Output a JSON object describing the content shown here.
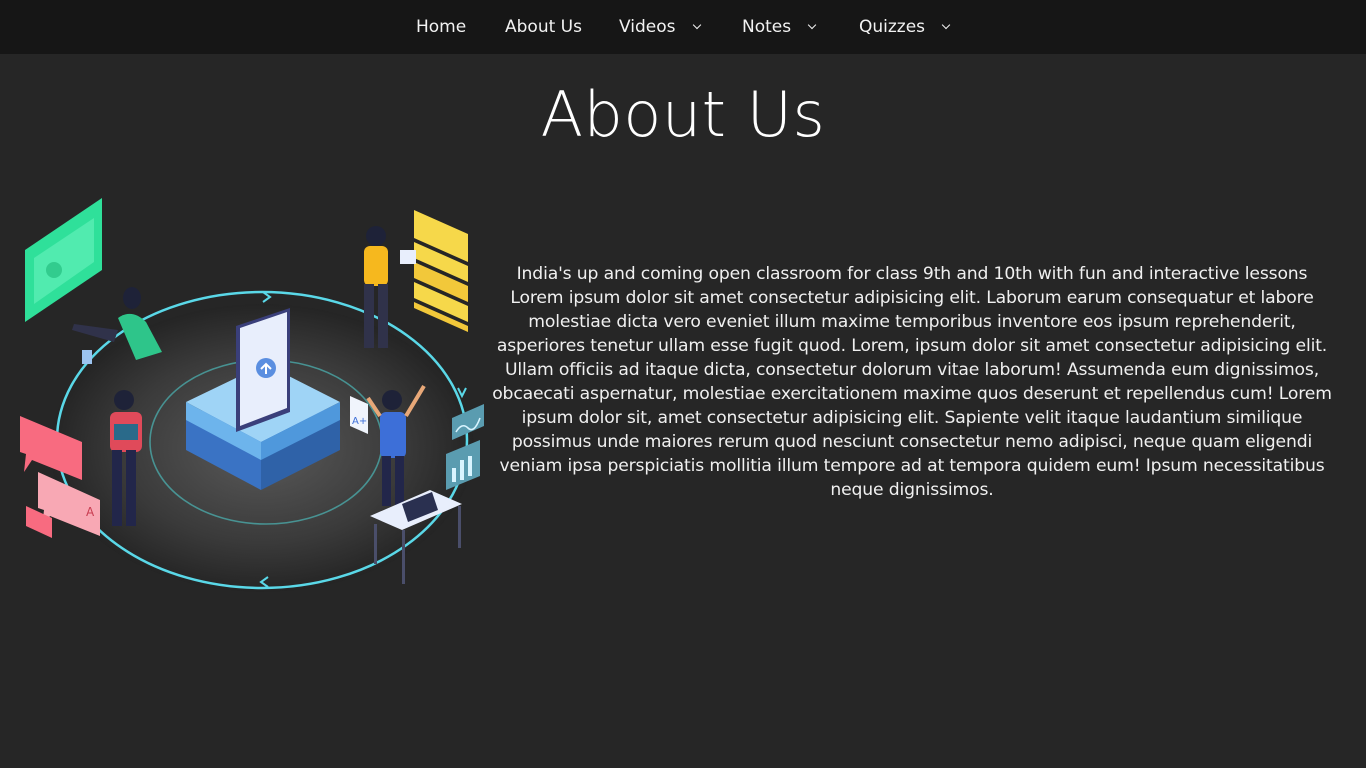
{
  "nav": {
    "items": [
      {
        "label": "Home",
        "dropdown": false
      },
      {
        "label": "About Us",
        "dropdown": false
      },
      {
        "label": "Videos",
        "dropdown": true
      },
      {
        "label": "Notes",
        "dropdown": true
      },
      {
        "label": "Quizzes",
        "dropdown": true
      }
    ]
  },
  "page": {
    "title": "About Us",
    "tagline": "India's up and coming open classroom for class 9th and 10th with fun and interactive lessons",
    "body": "Lorem ipsum dolor sit amet consectetur adipisicing elit. Laborum earum consequatur et labore molestiae dicta vero eveniet illum maxime temporibus inventore eos ipsum reprehenderit, asperiores tenetur ullam esse fugit quod. Lorem, ipsum dolor sit amet consectetur adipisicing elit. Ullam officiis ad itaque dicta, consectetur dolorum vitae laborum! Assumenda eum dignissimos, obcaecati aspernatur, molestiae exercitationem maxime quos deserunt et repellendus cum! Lorem ipsum dolor sit, amet consectetur adipisicing elit. Sapiente velit itaque laudantium similique possimus unde maiores rerum quod nesciunt consectetur nemo adipisci, neque quam eligendi veniam ipsa perspiciatis mollitia illum tempore ad at tempora quidem eum! Ipsum necessitatibus neque dignissimos."
  },
  "colors": {
    "background": "#262626",
    "navbar": "#161616",
    "accent_cyan": "#5ad8e8",
    "platform_blue": "#5aa8e8"
  }
}
